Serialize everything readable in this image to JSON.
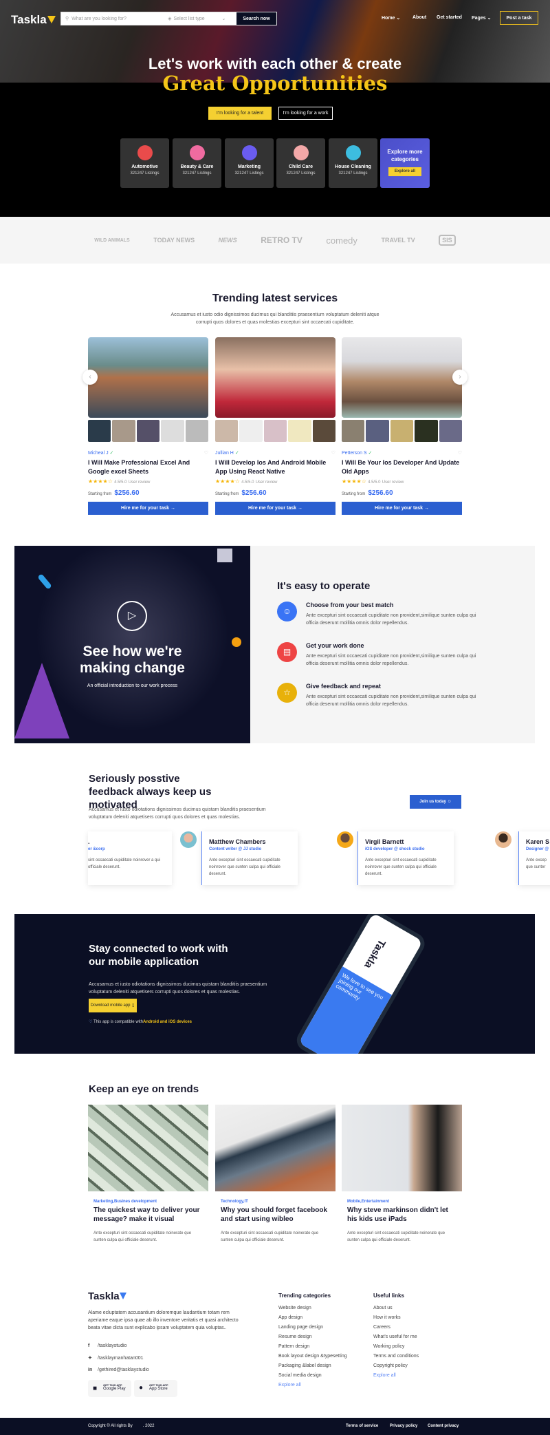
{
  "header": {
    "logo": "Taskla",
    "search_placeholder": "What are you looking for?",
    "list_type_placeholder": "Select list type",
    "search_button": "Search now",
    "nav": [
      "Home",
      "About",
      "Get started",
      "Pages"
    ],
    "post_task": "Post a task"
  },
  "hero": {
    "title_line1": "Let's work with each other & create",
    "title_line2": "Great Opportunities",
    "btn_talent": "I'm looking for a talent",
    "btn_work": "I'm looking for a work"
  },
  "categories": [
    {
      "name": "Automotive",
      "listings": "321247 Listings",
      "color": "#e94b4b"
    },
    {
      "name": "Beauty & Care",
      "listings": "321247 Listings",
      "color": "#f06ba0"
    },
    {
      "name": "Marketing",
      "listings": "321247 Listings",
      "color": "#6a5cf0"
    },
    {
      "name": "Child Care",
      "listings": "321247 Listings",
      "color": "#f3a8a8"
    },
    {
      "name": "House Cleaning",
      "listings": "321247 Listings",
      "color": "#3dbde0"
    }
  ],
  "explore": {
    "title": "Explore more categories",
    "button": "Explore all"
  },
  "partner_logos": [
    "WILD ANIMALS",
    "TODAY NEWS",
    "NEWS",
    "RETRO TV",
    "comedy",
    "TRAVEL TV",
    "SIS"
  ],
  "trending": {
    "title": "Trending latest services",
    "subtitle": "Accusamus et iusto odio dignissimos ducimus qui blanditiis praesentium voluptatum deleniti atque corrupti quos dolores et quas molestias excepturi sint occaecati cupiditate.",
    "services": [
      {
        "seller": "Micheal J",
        "title": "I Will Make Professional Excel And Google excel Sheets",
        "rating": "4.5/5.0",
        "review_label": "User review",
        "price_label": "Starting from",
        "price": "$256.60",
        "button": "Hire me for your task"
      },
      {
        "seller": "Jullian H",
        "title": "I Will Develop Ios And Android Mobile App Using React Native",
        "rating": "4.5/5.0",
        "review_label": "User review",
        "price_label": "Starting from",
        "price": "$256.60",
        "button": "Hire me for your task"
      },
      {
        "seller": "Petterson S",
        "title": "I Will Be Your Ios Developer And Update Old Apps",
        "rating": "4.5/5.0",
        "review_label": "User review",
        "price_label": "Starting from",
        "price": "$256.60",
        "button": "Hire me for your task"
      }
    ]
  },
  "video": {
    "title": "See how we're making change",
    "subtitle": "An official introduction to our work process"
  },
  "operate": {
    "title": "It's easy to operate",
    "steps": [
      {
        "title": "Choose from your best match",
        "text": "Ante excepturi sint occaecati cupiditate non provident,similique sunten culpa qui officia deserunt mollitia omnis dolor repellendus.",
        "color": "#3a74f5"
      },
      {
        "title": "Get your work done",
        "text": "Ante excepturi sint occaecati cupiditate non provident,similique sunten culpa qui officia deserunt mollitia omnis dolor repellendus.",
        "color": "#ee4444"
      },
      {
        "title": "Give feedback and repeat",
        "text": "Ante excepturi sint occaecati cupiditate non provident,similique sunten culpa qui officia deserunt mollitia omnis dolor repellendus.",
        "color": "#e8b10a"
      }
    ]
  },
  "feedback": {
    "title": "Seriously posstive feedback always keep us motivated",
    "text": "Accusamus et iusto odiotations dignissimos ducimus quistam blanditis praesentium voluptatum deleniti atquetisers corrupti quos dolores et quas molestias.",
    "join": "Join us today",
    "testimonials": [
      {
        "name": ".",
        "role": "er &corp",
        "quote": "sint occaecati cupiditate noinrover a qui officiale deserunt."
      },
      {
        "name": "Matthew Chambers",
        "role": "Content writer @ JJ studio",
        "quote": "Ante excepturi sint occaecati cupiditate noinrover que sunten culpa qui officiale deserunt."
      },
      {
        "name": "Virgil Barnett",
        "role": "iOS developer @ shock studio",
        "quote": "Ante excepturi sint occaecati cupiditate noinrover que sunten culpa qui officiale deserunt."
      },
      {
        "name": "Karen S",
        "role": "Designer @",
        "quote": "Ante excep que sunter"
      }
    ]
  },
  "mobile": {
    "title": "Stay connected to work with our mobile application",
    "text": "Accusamus et iusto odiotations dignissimos ducimus quistam blanditiis praesentium voluptatum deleniti atquetisers corrupti quos dolores et quas molestias.",
    "button": "Download mobile app",
    "compat_prefix": "This app is compatible with",
    "compat_highlight": "Android and iOS devices",
    "phone_brand": "Taskla",
    "phone_tagline": "We love to see you joining our community"
  },
  "trends": {
    "title": "Keep an eye on trends",
    "posts": [
      {
        "category": "Marketing,Busines development",
        "title": "The quickest way to deliver your message? make it visual",
        "text": "Ante excepturi sint occaecati cupiditate noinerate que sunten culpa qui officiale deserunt."
      },
      {
        "category": "Technology,IT",
        "title": "Why you should forget facebook and start using wibleo",
        "text": "Ante excepturi sint occaecati cupiditate noinerate que sunten culpa qui officiale deserunt."
      },
      {
        "category": "Mobile,Entertainment",
        "title": "Why steve markinson didn't let his kids use iPads",
        "text": "Ante excepturi sint occaecati cupiditate noinerate que sunten culpa qui officiale deserunt."
      }
    ]
  },
  "footer": {
    "logo": "Taskla",
    "about": "Alame ecluptatem accusantium doloremque laudantium totam rem aperiame eaque ipsa quae ab illo inventore veritatis et quasi architecto beata vitae dicta sunt explicabo ipsam voluptatem quia voluptas..",
    "social": [
      "/tasklaystudio",
      "/tasklaymanhatan001",
      "/gethired@tasklaystudio"
    ],
    "stores": [
      {
        "small": "GET THIS APP",
        "name": "Google Play"
      },
      {
        "small": "GET THIS APP",
        "name": "App Store"
      }
    ],
    "trending_title": "Trending categories",
    "trending": [
      "Website design",
      "App design",
      "Landing page design",
      "Resume design",
      "Pattern design",
      "Book layout design &typesetting",
      "Packaging &label design",
      "Social media design"
    ],
    "trending_more": "Explore all",
    "useful_title": "Useful links",
    "useful": [
      "About us",
      "How it works",
      "Careers",
      "What's useful for me",
      "Working policy",
      "Terms and conditions",
      "Copyright policy"
    ],
    "useful_more": "Explore all",
    "copyright": "Copyright © All rights By         . 2022",
    "legal": [
      "Terms of service",
      "Privacy policy",
      "Content privacy"
    ]
  }
}
